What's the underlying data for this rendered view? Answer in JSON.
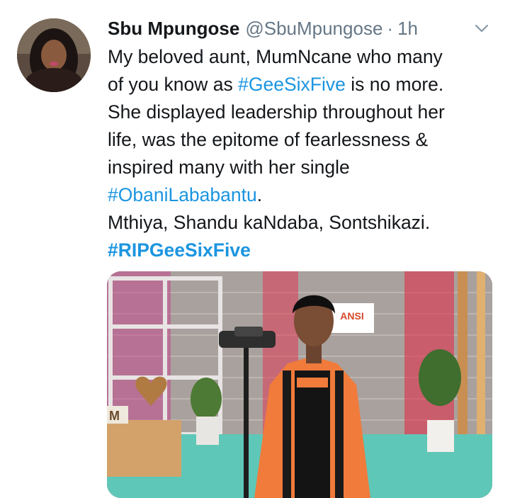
{
  "tweet": {
    "author_name": "Sbu Mpungose",
    "handle": "@SbuMpungose",
    "separator": "·",
    "time": "1h",
    "avatar_icon": "profile-photo",
    "menu_icon": "chevron-down-icon",
    "lines": {
      "l1": "My beloved aunt, MumNcane who many",
      "l2a": "of you know as ",
      "l2tag": "#GeeSixFive",
      "l2b": " is no more.",
      "l3": "She displayed leadership throughout her",
      "l4": "life, was the epitome of fearlessness &",
      "l5": "inspired many with her single",
      "l6tag": "#ObaniLababantu",
      "l6b": ".",
      "l7": "Mthiya, Shandu kaNdaba, Sontshikazi.",
      "l8tag": "#RIPGeeSixFive"
    },
    "media": {
      "sign_text": "ANSI",
      "shelf_letter": "M"
    }
  },
  "colors": {
    "link": "#1b95e0",
    "secondary_text": "#657786",
    "jacket_orange": "#f07b3b"
  }
}
